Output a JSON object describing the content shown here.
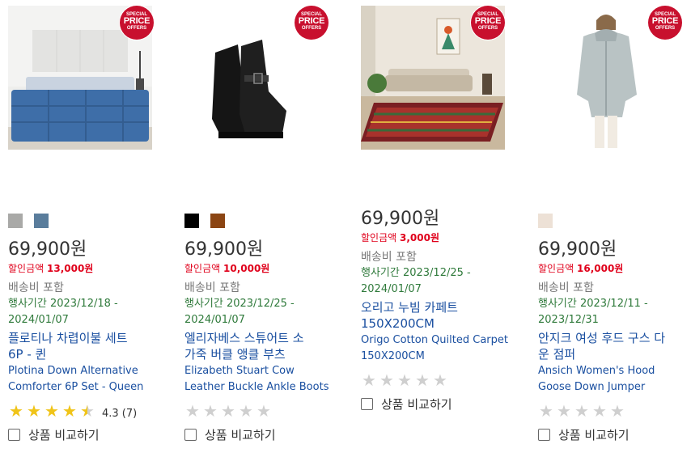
{
  "badge": {
    "line1": "SPECIAL",
    "line2": "PRICE",
    "line3": "OFFERS"
  },
  "compare_label": "상품 비교하기",
  "products": [
    {
      "colors": [
        "#a9a9a7",
        "#5a7d9c"
      ],
      "price": "69,900원",
      "discount_label": "할인금액",
      "discount_value": "13,000원",
      "shipping": "배송비 포함",
      "period_line1": "행사기간 2023/12/18 -",
      "period_line2": "2024/01/07",
      "name_ko_line1": "플로티나 차렵이불 세트",
      "name_ko_line2": "6P - 퀸",
      "name_en_line1": "Plotina Down Alternative",
      "name_en_line2": "Comforter 6P Set - Queen",
      "rating": 4.3,
      "rating_text": "4.3 (7)",
      "image_icon": "bedding-set-image"
    },
    {
      "colors": [
        "#000000",
        "#8b4513"
      ],
      "price": "69,900원",
      "discount_label": "할인금액",
      "discount_value": "10,000원",
      "shipping": "배송비 포함",
      "period_line1": "행사기간 2023/12/25 -",
      "period_line2": "2024/01/07",
      "name_ko_line1": "엘리자베스 스튜어트 소",
      "name_ko_line2": "가죽 버클 앵클 부츠",
      "name_en_line1": "Elizabeth Stuart Cow",
      "name_en_line2": "Leather Buckle Ankle Boots",
      "rating": 0,
      "rating_text": "",
      "image_icon": "ankle-boots-image"
    },
    {
      "colors": [],
      "price": "69,900원",
      "discount_label": "할인금액",
      "discount_value": "3,000원",
      "shipping": "배송비 포함",
      "period_line1": "행사기간 2023/12/25 -",
      "period_line2": "2024/01/07",
      "name_ko_line1": "오리고 누빔 카페트",
      "name_ko_line2": "150X200CM",
      "name_en_line1": "Origo Cotton Quilted Carpet",
      "name_en_line2": "150X200CM",
      "rating": 0,
      "rating_text": "",
      "image_icon": "carpet-image"
    },
    {
      "colors": [
        "#ede1d6"
      ],
      "price": "69,900원",
      "discount_label": "할인금액",
      "discount_value": "16,000원",
      "shipping": "배송비 포함",
      "period_line1": "행사기간 2023/12/11 -",
      "period_line2": "2023/12/31",
      "name_ko_line1": "안지크 여성 후드 구스 다",
      "name_ko_line2": "운 점퍼",
      "name_en_line1": "Ansich Women's Hood",
      "name_en_line2": "Goose Down Jumper",
      "rating": 0,
      "rating_text": "",
      "image_icon": "down-jumper-image"
    }
  ]
}
